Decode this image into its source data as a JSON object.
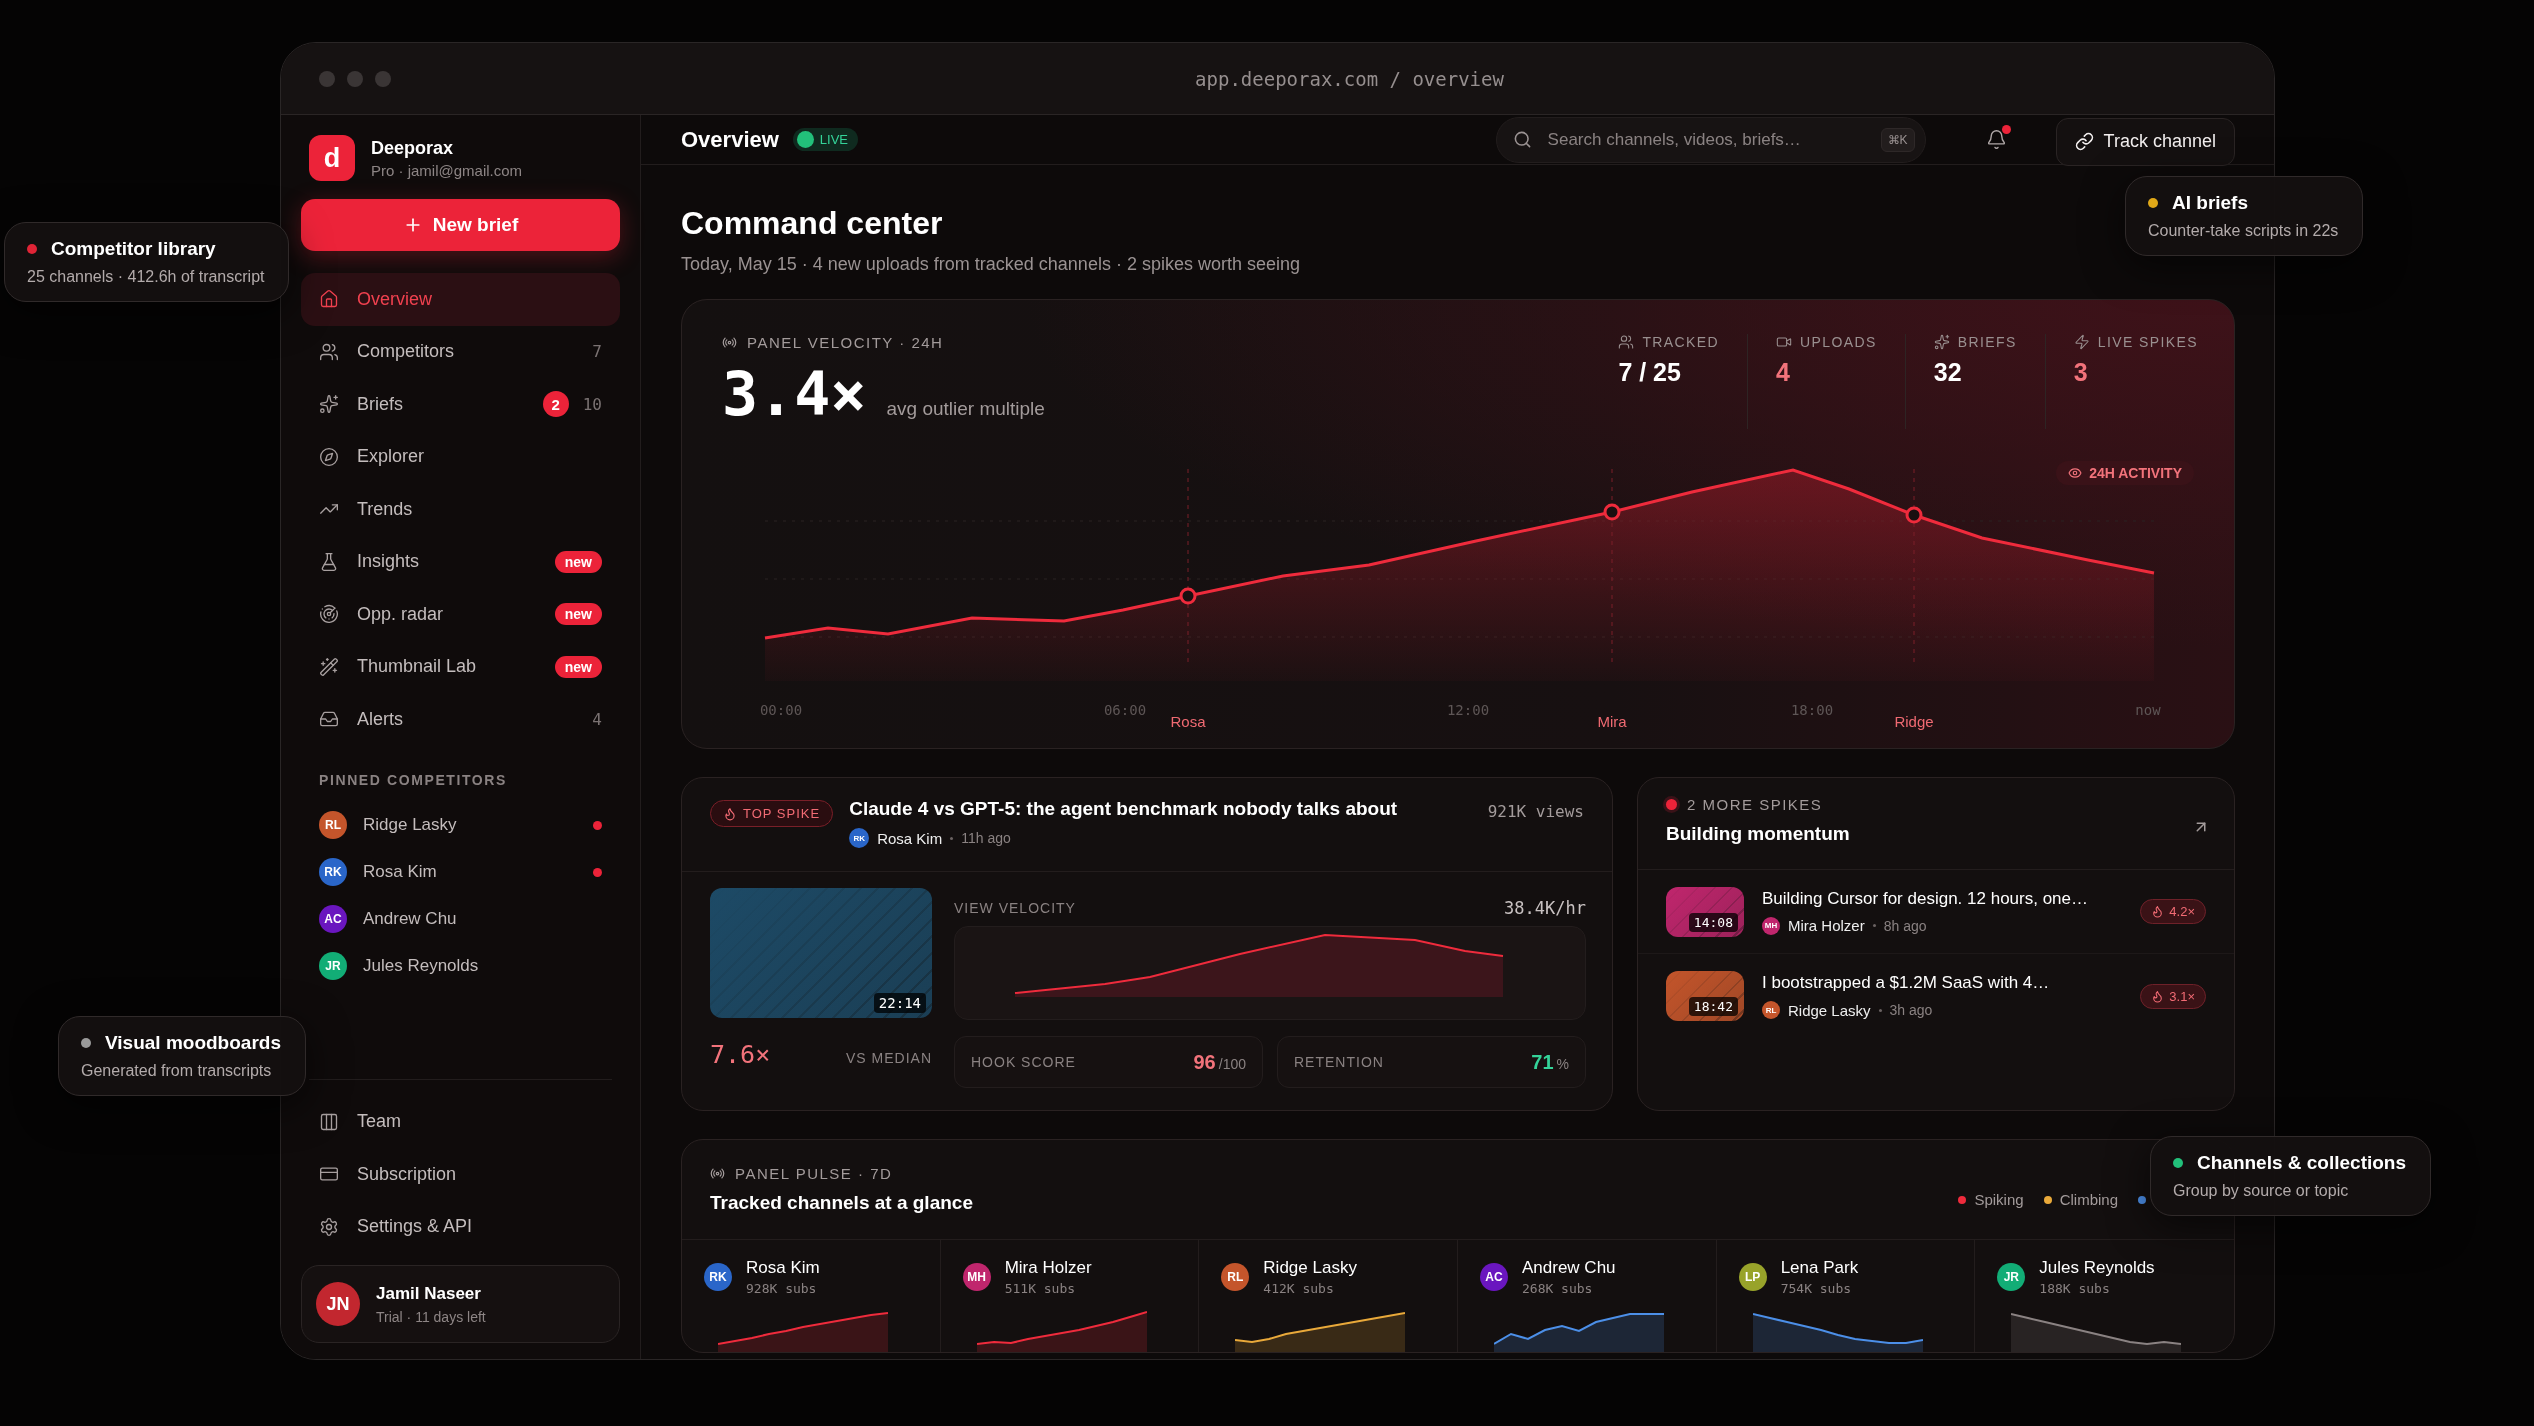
{
  "window": {
    "address": "app.deeporax.com / overview"
  },
  "sidebar": {
    "brand": {
      "logo": "d",
      "name": "Deeporax",
      "plan": "Pro · jamil@gmail.com"
    },
    "new_button": "New brief",
    "nav": [
      {
        "label": "Overview",
        "selected": true
      },
      {
        "label": "Competitors",
        "selected": false,
        "count": "7"
      },
      {
        "label": "Briefs",
        "selected": false,
        "badge": "2",
        "count": "10"
      },
      {
        "label": "Explorer",
        "selected": false
      },
      {
        "label": "Trends",
        "selected": false
      },
      {
        "label": "Insights",
        "selected": false,
        "tag": "new"
      },
      {
        "label": "Opp. radar",
        "selected": false,
        "tag": "new"
      },
      {
        "label": "Thumbnail Lab",
        "selected": false,
        "tag": "new"
      },
      {
        "label": "Alerts",
        "selected": false,
        "count": "4"
      }
    ],
    "pinned_heading": "PINNED COMPETITORS",
    "pinned": [
      {
        "initials": "RL",
        "name": "Ridge Lasky",
        "color": "#c4552b",
        "alert": true
      },
      {
        "initials": "RK",
        "name": "Rosa Kim",
        "color": "#2a66c9",
        "alert": true
      },
      {
        "initials": "AC",
        "name": "Andrew Chu",
        "color": "#6a16bf",
        "alert": false
      },
      {
        "initials": "JR",
        "name": "Jules Reynolds",
        "color": "#12ad76",
        "alert": false
      }
    ],
    "footer_nav": [
      {
        "label": "Team"
      },
      {
        "label": "Subscription"
      },
      {
        "label": "Settings & API"
      }
    ],
    "user": {
      "initials": "JN",
      "name": "Jamil Naseer",
      "status": "Trial · 11 days left"
    }
  },
  "header": {
    "title": "Overview",
    "live": "LIVE",
    "search": {
      "placeholder": "Search channels, videos, briefs…",
      "shortcut": "⌘K"
    },
    "unread": true,
    "track_button": "Track channel"
  },
  "page": {
    "title": "Command center",
    "subtitle": "Today, May 15 · 4 new uploads from tracked channels · 2 spikes worth seeing"
  },
  "velocity": {
    "label": "PANEL VELOCITY · 24H",
    "value": "3.4×",
    "caption": "avg outlier multiple",
    "stats": [
      {
        "label": "TRACKED",
        "value": "7 / 25",
        "accent": false
      },
      {
        "label": "UPLOADS",
        "value": "4",
        "accent": true
      },
      {
        "label": "BRIEFS",
        "value": "32",
        "accent": false
      },
      {
        "label": "LIVE SPIKES",
        "value": "3",
        "accent": true
      }
    ],
    "activity_badge": "24H ACTIVITY",
    "x_labels": [
      "00:00",
      "06:00",
      "12:00",
      "18:00",
      "now"
    ],
    "markers": [
      "Rosa",
      "Mira",
      "Ridge"
    ]
  },
  "top_spike": {
    "badge": "TOP SPIKE",
    "title": "Claude 4 vs GPT-5: the agent benchmark nobody talks about",
    "author": {
      "initials": "RK",
      "name": "Rosa Kim",
      "color": "#2a66c9"
    },
    "age": "11h ago",
    "views": "921K views",
    "duration": "22:14",
    "multiple": "7.6×",
    "multiple_caption": "VS MEDIAN",
    "velocity_label": "VIEW VELOCITY",
    "velocity_value": "38.4K/hr",
    "metrics": [
      {
        "label": "HOOK SCORE",
        "value": "96",
        "unit": "/100",
        "color": "#f2737b"
      },
      {
        "label": "RETENTION",
        "value": "71",
        "unit": "%",
        "color": "#34d399"
      }
    ]
  },
  "more_spikes": {
    "heading": "2 MORE SPIKES",
    "title": "Building momentum",
    "items": [
      {
        "title": "Building Cursor for design. 12 hours, one…",
        "duration": "14:08",
        "author": {
          "initials": "MH",
          "name": "Mira Holzer",
          "color": "#c0266d"
        },
        "age": "8h ago",
        "multiple": "4.2×"
      },
      {
        "title": "I bootstrapped a $1.2M SaaS with 4…",
        "duration": "18:42",
        "author": {
          "initials": "RL",
          "name": "Ridge Lasky",
          "color": "#c4552b"
        },
        "age": "3h ago",
        "multiple": "3.1×"
      }
    ]
  },
  "pulse": {
    "label": "PANEL PULSE · 7D",
    "title": "Tracked channels at a glance",
    "legend": [
      {
        "label": "Spiking",
        "kind": "spiking"
      },
      {
        "label": "Climbing",
        "kind": "climbing"
      },
      {
        "kind": "steady"
      }
    ],
    "channels": [
      {
        "initials": "RK",
        "name": "Rosa Kim",
        "subs": "928K subs",
        "color": "#2a66c9",
        "kind": "spiking"
      },
      {
        "initials": "MH",
        "name": "Mira Holzer",
        "subs": "511K subs",
        "color": "#c0266d",
        "kind": "spiking"
      },
      {
        "initials": "RL",
        "name": "Ridge Lasky",
        "subs": "412K subs",
        "color": "#c4552b",
        "kind": "climbing"
      },
      {
        "initials": "AC",
        "name": "Andrew Chu",
        "subs": "268K subs",
        "color": "#6a16bf",
        "kind": "steady"
      },
      {
        "initials": "LP",
        "name": "Lena Park",
        "subs": "754K subs",
        "color": "#98a32a",
        "kind": "steady"
      },
      {
        "initials": "JR",
        "name": "Jules Reynolds",
        "subs": "188K subs",
        "color": "#12ad76",
        "kind": "cooling"
      }
    ]
  },
  "callouts": [
    {
      "title": "Competitor library",
      "text": "25 channels · 412.6h of transcript",
      "color": "#e02436"
    },
    {
      "title": "AI briefs",
      "text": "Counter-take scripts in 22s",
      "color": "#e0a818"
    },
    {
      "title": "Visual moodboards",
      "text": "Generated from transcripts",
      "color": "#9a9a9a"
    },
    {
      "title": "Channels & collections",
      "text": "Group by source or topic",
      "color": "#22c07a"
    }
  ]
}
